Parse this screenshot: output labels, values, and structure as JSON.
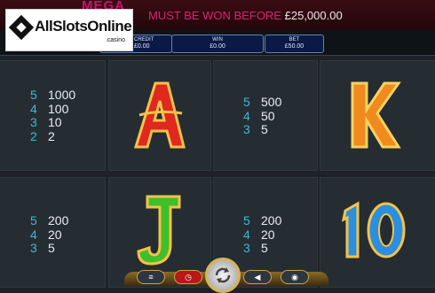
{
  "jackpot": {
    "mega_label": "MEGA",
    "must_be_won_text": "MUST BE WON BEFORE",
    "amount": "£25,000.00"
  },
  "meters": {
    "credit_label": "CREDIT",
    "credit_value": "£0.00",
    "win_label": "WIN",
    "win_value": "£0.00",
    "bet_label": "BET",
    "bet_value": "£50.00"
  },
  "logo": {
    "text": "AllSlotsOnline",
    "sub": ".casino"
  },
  "paytables": [
    {
      "rows": [
        {
          "count": "5",
          "value": "1000"
        },
        {
          "count": "4",
          "value": "100"
        },
        {
          "count": "3",
          "value": "10"
        },
        {
          "count": "2",
          "value": "2"
        }
      ]
    },
    {
      "rows": [
        {
          "count": "5",
          "value": "500"
        },
        {
          "count": "4",
          "value": "50"
        },
        {
          "count": "3",
          "value": "5"
        }
      ]
    },
    {
      "rows": [
        {
          "count": "5",
          "value": "200"
        },
        {
          "count": "4",
          "value": "20"
        },
        {
          "count": "3",
          "value": "5"
        }
      ]
    },
    {
      "rows": [
        {
          "count": "5",
          "value": "200"
        },
        {
          "count": "4",
          "value": "20"
        },
        {
          "count": "3",
          "value": "5"
        }
      ]
    }
  ],
  "symbols": [
    {
      "name": "A",
      "color": "#e0281e"
    },
    {
      "name": "K",
      "color": "#f08a1c"
    },
    {
      "name": "J",
      "color": "#3fbf2a"
    },
    {
      "name": "10",
      "color": "#2a8fe0"
    }
  ],
  "controls": {
    "icons": [
      "coin-stack-icon",
      "speed-gauge-icon",
      "spin-icon",
      "sound-icon",
      "menu-icon"
    ]
  }
}
